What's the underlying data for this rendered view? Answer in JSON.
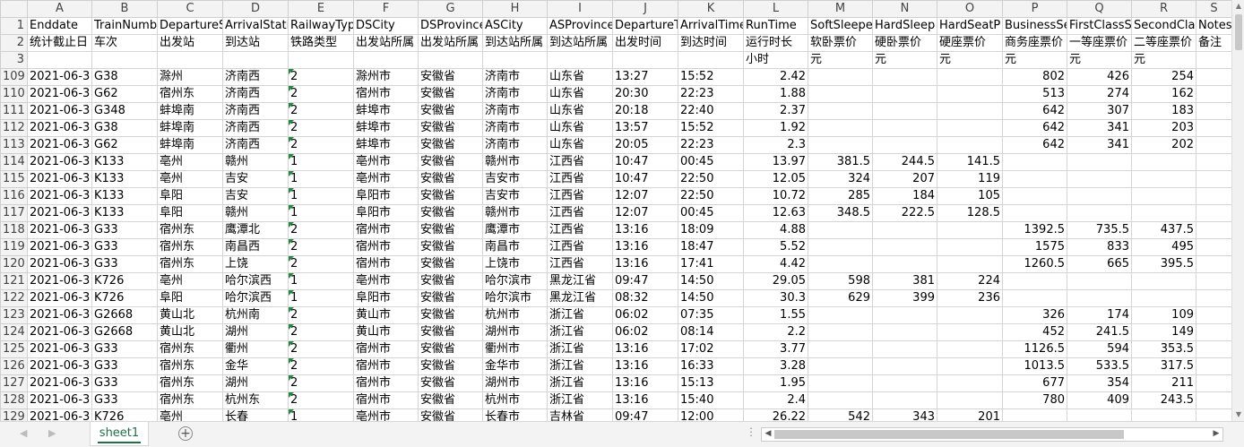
{
  "columns": [
    "A",
    "B",
    "C",
    "D",
    "E",
    "F",
    "G",
    "H",
    "I",
    "J",
    "K",
    "L",
    "M",
    "N",
    "O",
    "P",
    "Q",
    "R",
    "S"
  ],
  "header_rows": [
    {
      "num": "1",
      "cells": [
        "Enddate",
        "TrainNumb",
        "DepartureS",
        "ArrivalStati",
        "RailwayTyp",
        "DSCity",
        "DSProvince",
        "ASCity",
        "ASProvince",
        "DepartureT",
        "ArrivalTime",
        "RunTime",
        "SoftSleepe",
        "HardSleep",
        "HardSeatP",
        "BusinessSe",
        "FirstClassS",
        "SecondCla",
        "Notes"
      ]
    },
    {
      "num": "2",
      "cells": [
        "统计截止日",
        "车次",
        "出发站",
        "到达站",
        "铁路类型",
        "出发站所属",
        "出发站所属",
        "到达站所属",
        "到达站所属",
        "出发时间",
        "到达时间",
        "运行时长",
        "软卧票价",
        "硬卧票价",
        "硬座票价",
        "商务座票价",
        "一等座票价",
        "二等座票价",
        "备注"
      ]
    },
    {
      "num": "3",
      "cells": [
        "",
        "",
        "",
        "",
        "",
        "",
        "",
        "",
        "",
        "",
        "",
        "小时",
        "元",
        "元",
        "元",
        "元",
        "元",
        "元",
        ""
      ]
    }
  ],
  "data_rows": [
    {
      "num": "109",
      "cells": [
        "2021-06-3",
        "G38",
        "滁州",
        "济南西",
        "2",
        "滁州市",
        "安徽省",
        "济南市",
        "山东省",
        "13:27",
        "15:52",
        "2.42",
        "",
        "",
        "",
        "802",
        "426",
        "254",
        ""
      ]
    },
    {
      "num": "110",
      "cells": [
        "2021-06-3",
        "G62",
        "宿州东",
        "济南西",
        "2",
        "宿州市",
        "安徽省",
        "济南市",
        "山东省",
        "20:30",
        "22:23",
        "1.88",
        "",
        "",
        "",
        "513",
        "274",
        "162",
        ""
      ]
    },
    {
      "num": "111",
      "cells": [
        "2021-06-3",
        "G348",
        "蚌埠南",
        "济南西",
        "2",
        "蚌埠市",
        "安徽省",
        "济南市",
        "山东省",
        "20:18",
        "22:40",
        "2.37",
        "",
        "",
        "",
        "642",
        "307",
        "183",
        ""
      ]
    },
    {
      "num": "112",
      "cells": [
        "2021-06-3",
        "G38",
        "蚌埠南",
        "济南西",
        "2",
        "蚌埠市",
        "安徽省",
        "济南市",
        "山东省",
        "13:57",
        "15:52",
        "1.92",
        "",
        "",
        "",
        "642",
        "341",
        "203",
        ""
      ]
    },
    {
      "num": "113",
      "cells": [
        "2021-06-3",
        "G62",
        "蚌埠南",
        "济南西",
        "2",
        "蚌埠市",
        "安徽省",
        "济南市",
        "山东省",
        "20:05",
        "22:23",
        "2.3",
        "",
        "",
        "",
        "642",
        "341",
        "202",
        ""
      ]
    },
    {
      "num": "114",
      "cells": [
        "2021-06-3",
        "K133",
        "亳州",
        "赣州",
        "1",
        "亳州市",
        "安徽省",
        "赣州市",
        "江西省",
        "10:47",
        "00:45",
        "13.97",
        "381.5",
        "244.5",
        "141.5",
        "",
        "",
        "",
        ""
      ]
    },
    {
      "num": "115",
      "cells": [
        "2021-06-3",
        "K133",
        "亳州",
        "吉安",
        "1",
        "亳州市",
        "安徽省",
        "吉安市",
        "江西省",
        "10:47",
        "22:50",
        "12.05",
        "324",
        "207",
        "119",
        "",
        "",
        "",
        ""
      ]
    },
    {
      "num": "116",
      "cells": [
        "2021-06-3",
        "K133",
        "阜阳",
        "吉安",
        "1",
        "阜阳市",
        "安徽省",
        "吉安市",
        "江西省",
        "12:07",
        "22:50",
        "10.72",
        "285",
        "184",
        "105",
        "",
        "",
        "",
        ""
      ]
    },
    {
      "num": "117",
      "cells": [
        "2021-06-3",
        "K133",
        "阜阳",
        "赣州",
        "1",
        "阜阳市",
        "安徽省",
        "赣州市",
        "江西省",
        "12:07",
        "00:45",
        "12.63",
        "348.5",
        "222.5",
        "128.5",
        "",
        "",
        "",
        ""
      ]
    },
    {
      "num": "118",
      "cells": [
        "2021-06-3",
        "G33",
        "宿州东",
        "鹰潭北",
        "2",
        "宿州市",
        "安徽省",
        "鹰潭市",
        "江西省",
        "13:16",
        "18:09",
        "4.88",
        "",
        "",
        "",
        "1392.5",
        "735.5",
        "437.5",
        ""
      ]
    },
    {
      "num": "119",
      "cells": [
        "2021-06-3",
        "G33",
        "宿州东",
        "南昌西",
        "2",
        "宿州市",
        "安徽省",
        "南昌市",
        "江西省",
        "13:16",
        "18:47",
        "5.52",
        "",
        "",
        "",
        "1575",
        "833",
        "495",
        ""
      ]
    },
    {
      "num": "120",
      "cells": [
        "2021-06-3",
        "G33",
        "宿州东",
        "上饶",
        "2",
        "宿州市",
        "安徽省",
        "上饶市",
        "江西省",
        "13:16",
        "17:41",
        "4.42",
        "",
        "",
        "",
        "1260.5",
        "665",
        "395.5",
        ""
      ]
    },
    {
      "num": "121",
      "cells": [
        "2021-06-3",
        "K726",
        "亳州",
        "哈尔滨西",
        "1",
        "亳州市",
        "安徽省",
        "哈尔滨市",
        "黑龙江省",
        "09:47",
        "14:50",
        "29.05",
        "598",
        "381",
        "224",
        "",
        "",
        "",
        ""
      ]
    },
    {
      "num": "122",
      "cells": [
        "2021-06-3",
        "K726",
        "阜阳",
        "哈尔滨西",
        "1",
        "阜阳市",
        "安徽省",
        "哈尔滨市",
        "黑龙江省",
        "08:32",
        "14:50",
        "30.3",
        "629",
        "399",
        "236",
        "",
        "",
        "",
        ""
      ]
    },
    {
      "num": "123",
      "cells": [
        "2021-06-3",
        "G2668",
        "黄山北",
        "杭州南",
        "2",
        "黄山市",
        "安徽省",
        "杭州市",
        "浙江省",
        "06:02",
        "07:35",
        "1.55",
        "",
        "",
        "",
        "326",
        "174",
        "109",
        ""
      ]
    },
    {
      "num": "124",
      "cells": [
        "2021-06-3",
        "G2668",
        "黄山北",
        "湖州",
        "2",
        "黄山市",
        "安徽省",
        "湖州市",
        "浙江省",
        "06:02",
        "08:14",
        "2.2",
        "",
        "",
        "",
        "452",
        "241.5",
        "149",
        ""
      ]
    },
    {
      "num": "125",
      "cells": [
        "2021-06-3",
        "G33",
        "宿州东",
        "衢州",
        "2",
        "宿州市",
        "安徽省",
        "衢州市",
        "浙江省",
        "13:16",
        "17:02",
        "3.77",
        "",
        "",
        "",
        "1126.5",
        "594",
        "353.5",
        ""
      ]
    },
    {
      "num": "126",
      "cells": [
        "2021-06-3",
        "G33",
        "宿州东",
        "金华",
        "2",
        "宿州市",
        "安徽省",
        "金华市",
        "浙江省",
        "13:16",
        "16:33",
        "3.28",
        "",
        "",
        "",
        "1013.5",
        "533.5",
        "317.5",
        ""
      ]
    },
    {
      "num": "127",
      "cells": [
        "2021-06-3",
        "G33",
        "宿州东",
        "湖州",
        "2",
        "宿州市",
        "安徽省",
        "湖州市",
        "浙江省",
        "13:16",
        "15:13",
        "1.95",
        "",
        "",
        "",
        "677",
        "354",
        "211",
        ""
      ]
    },
    {
      "num": "128",
      "cells": [
        "2021-06-3",
        "G33",
        "宿州东",
        "杭州东",
        "2",
        "宿州市",
        "安徽省",
        "杭州市",
        "浙江省",
        "13:16",
        "15:40",
        "2.4",
        "",
        "",
        "",
        "780",
        "409",
        "243.5",
        ""
      ]
    },
    {
      "num": "129",
      "cells": [
        "2021-06-3",
        "K726",
        "亳州",
        "长春",
        "1",
        "亳州市",
        "安徽省",
        "长春市",
        "吉林省",
        "09:47",
        "12:00",
        "26.22",
        "542",
        "343",
        "201",
        "",
        "",
        "",
        ""
      ]
    }
  ],
  "sheet_tab": "sheet1",
  "add_sheet_symbol": "+",
  "dots_symbol": "⋮",
  "scroll_left": "◀",
  "scroll_right": "▶",
  "scroll_up": "▲",
  "scroll_down": "▼",
  "nav_prev": "◀",
  "nav_next": "▶"
}
